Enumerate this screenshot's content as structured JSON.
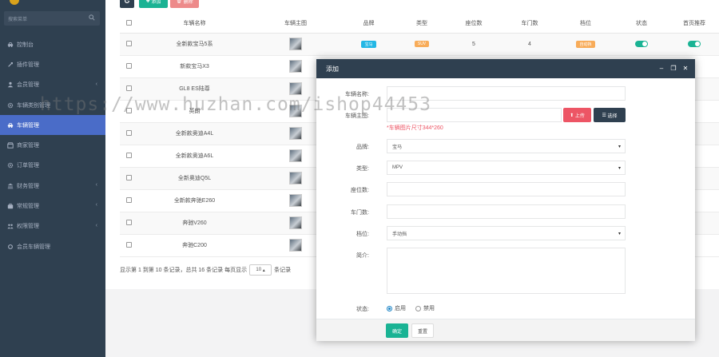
{
  "sidebar": {
    "search_placeholder": "搜索菜单",
    "items": [
      {
        "label": "控制台",
        "icon": "car-icon",
        "caret": ""
      },
      {
        "label": "插件管理",
        "icon": "plugin-icon",
        "caret": ""
      },
      {
        "label": "会员管理",
        "icon": "users-icon",
        "caret": "‹"
      },
      {
        "label": "车辆类别管理",
        "icon": "gear-icon",
        "caret": ""
      },
      {
        "label": "车辆管理",
        "icon": "car-icon",
        "caret": "",
        "active": true
      },
      {
        "label": "商家管理",
        "icon": "store-icon",
        "caret": ""
      },
      {
        "label": "订单管理",
        "icon": "gear-icon",
        "caret": ""
      },
      {
        "label": "财务管理",
        "icon": "bank-icon",
        "caret": "‹"
      },
      {
        "label": "常规管理",
        "icon": "briefcase-icon",
        "caret": "‹"
      },
      {
        "label": "权限管理",
        "icon": "group-icon",
        "caret": "‹"
      },
      {
        "label": "会员车辆管理",
        "icon": "circle-icon",
        "caret": ""
      }
    ]
  },
  "toolbar": {
    "add_label": "添加",
    "delete_label": "删除"
  },
  "table": {
    "columns": [
      "车辆名称",
      "车辆主图",
      "品牌",
      "类型",
      "座位数",
      "车门数",
      "档位",
      "状态",
      "首页推荐"
    ],
    "rows": [
      {
        "name": "全新款宝马5系",
        "brand": "宝马",
        "type": "SUV",
        "seats": "5",
        "doors": "4",
        "gear": "自动挡",
        "brand_color": "#23b7e5",
        "type_color": "#f8ac59",
        "gear_color": "#f8ac59",
        "status_on": true,
        "recommend_on": true
      },
      {
        "name": "新款宝马X3"
      },
      {
        "name": "GL8 ES陆尊"
      },
      {
        "name": "英朗"
      },
      {
        "name": "全新款奥迪A4L"
      },
      {
        "name": "全新款奥迪A6L"
      },
      {
        "name": "全新奥迪Q5L"
      },
      {
        "name": "全新款奔驰E260"
      },
      {
        "name": "奔驰V260"
      },
      {
        "name": "奔驰C200"
      }
    ]
  },
  "pager": {
    "info": "显示第 1 到第 10 条记录，总共 16 条记录 每页显示",
    "per_page": "10",
    "suffix": "条记录"
  },
  "modal": {
    "title": "添加",
    "fields": {
      "name_label": "车辆名称:",
      "image_label": "车辆主图:",
      "upload_label": "上传",
      "choose_label": "选择",
      "image_hint": "*车辆图片尺寸344*260",
      "brand_label": "品牌:",
      "brand_value": "宝马",
      "type_label": "类型:",
      "type_value": "MPV",
      "seats_label": "座位数:",
      "doors_label": "车门数:",
      "gear_label": "档位:",
      "gear_value": "手动挡",
      "intro_label": "简介:",
      "status_label": "状态:",
      "status_on_label": "启用",
      "status_off_label": "禁用"
    },
    "confirm_label": "确定",
    "reset_label": "重置"
  },
  "watermark": "https://www.huzhan.com/ishop44453",
  "colors": {
    "sidebar": "#2f4050",
    "active": "#4a6cc8",
    "primary": "#1ab394",
    "danger": "#ed5565"
  }
}
